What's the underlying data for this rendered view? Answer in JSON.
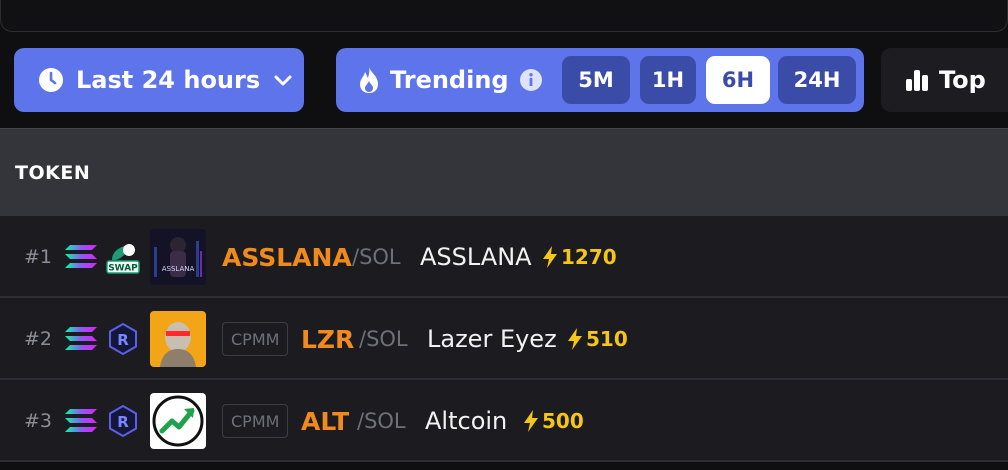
{
  "filters": {
    "time_range_label": "Last 24 hours",
    "trending_label": "Trending",
    "intervals": [
      "5M",
      "1H",
      "6H",
      "24H"
    ],
    "active_interval": "6H",
    "top_label": "Top"
  },
  "table": {
    "header": "TOKEN",
    "rows": [
      {
        "rank": "#1",
        "dex": "SWAP",
        "pool": "",
        "symbol": "ASSLANA",
        "pair": "/SOL",
        "name": "ASSLANA",
        "boost": "1270",
        "image_text": "ASSLANA"
      },
      {
        "rank": "#2",
        "dex": "R",
        "pool": "CPMM",
        "symbol": "LZR",
        "pair": "/SOL",
        "name": "Lazer Eyez",
        "boost": "510"
      },
      {
        "rank": "#3",
        "dex": "R",
        "pool": "CPMM",
        "symbol": "ALT",
        "pair": "/SOL",
        "name": "Altcoin",
        "boost": "500"
      }
    ]
  },
  "colors": {
    "accent": "#5d74ea",
    "symbol": "#f08a1c",
    "boost": "#f5c518"
  }
}
